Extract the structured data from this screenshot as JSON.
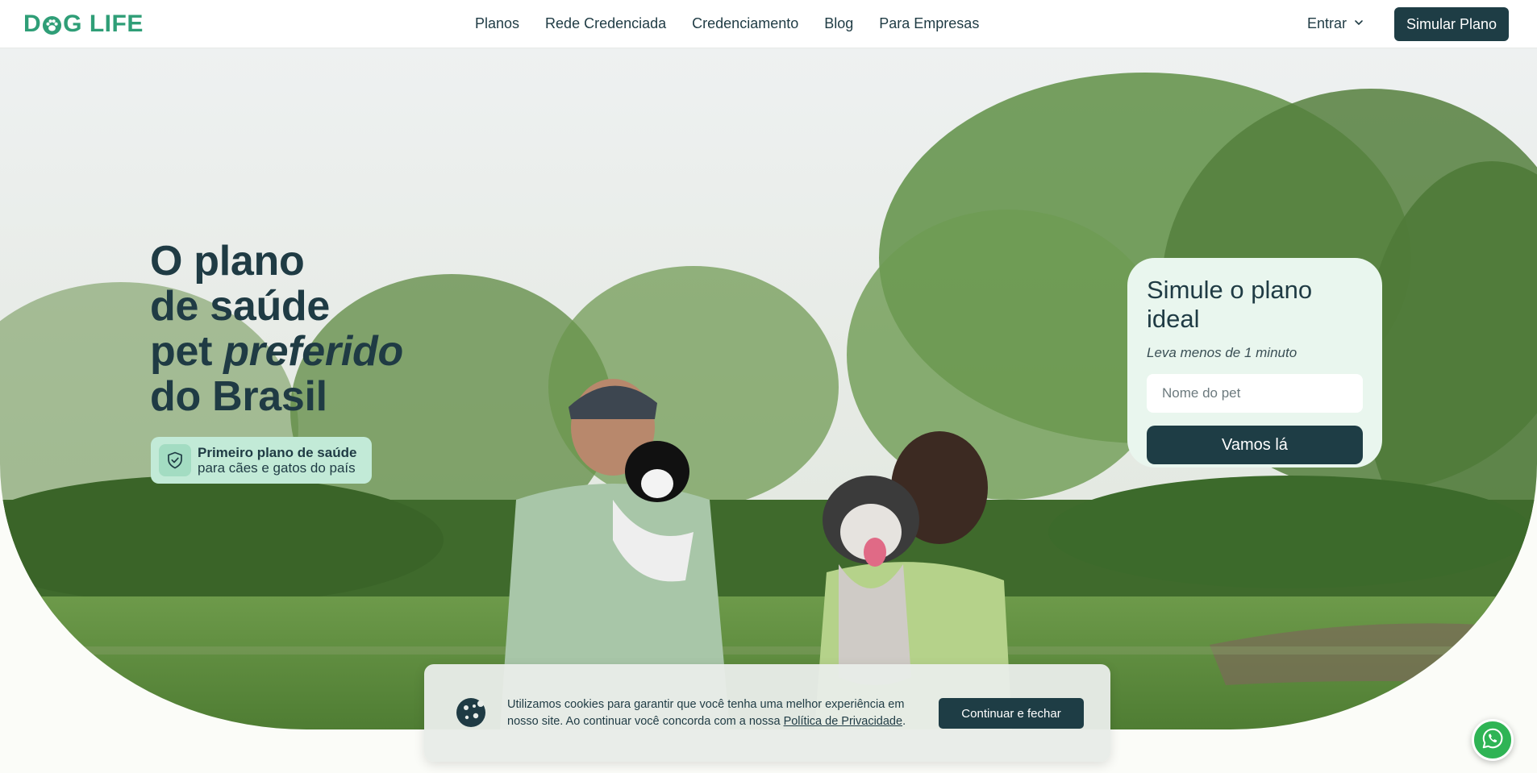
{
  "header": {
    "logo_left": "D",
    "logo_right": "G LIFE",
    "logo_icon": "paw-icon",
    "nav": [
      {
        "label": "Planos"
      },
      {
        "label": "Rede Credenciada"
      },
      {
        "label": "Credenciamento"
      },
      {
        "label": "Blog"
      },
      {
        "label": "Para Empresas"
      }
    ],
    "login_label": "Entrar",
    "login_icon": "chevron-down-icon",
    "cta_label": "Simular Plano"
  },
  "hero": {
    "headline": {
      "line1": "O plano",
      "line2": "de saúde",
      "line3_prefix": "pet ",
      "line3_emphasis": "preferido",
      "line4": "do Brasil"
    },
    "badge": {
      "icon": "shield-check-icon",
      "title": "Primeiro plano de saúde",
      "subtitle": "para cães e gatos do país"
    },
    "image_description_icon": "hero-photo"
  },
  "simulator": {
    "title": "Simule o plano ideal",
    "subtitle": "Leva menos de 1 minuto",
    "input_placeholder": "Nome do pet",
    "input_value": "",
    "button_label": "Vamos lá"
  },
  "cookie_banner": {
    "icon": "cookie-icon",
    "text_before_link": "Utilizamos cookies para garantir que você tenha uma melhor experiência em nosso site. Ao continuar você concorda com a nossa ",
    "link_label": "Política de Privacidade",
    "text_after_link": ".",
    "button_label": "Continuar e fechar"
  },
  "whatsapp": {
    "icon": "whatsapp-icon"
  },
  "colors": {
    "brand_green": "#2f9e77",
    "dark_teal": "#1e3d45",
    "badge_bg": "#c2ead7",
    "card_bg": "#e9f6ee",
    "whatsapp_green": "#2fb455"
  }
}
